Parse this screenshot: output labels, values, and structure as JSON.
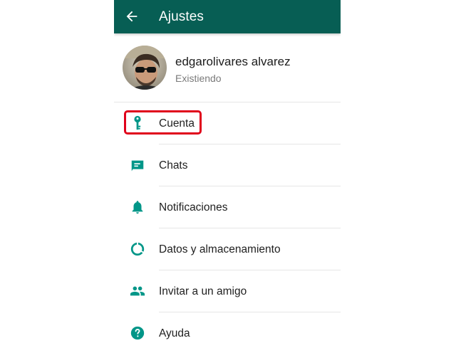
{
  "appbar": {
    "title": "Ajustes",
    "back_icon": "arrow-left-icon"
  },
  "profile": {
    "name": "edgarolivares alvarez",
    "status": "Existiendo"
  },
  "settings": {
    "items": [
      {
        "label": "Cuenta",
        "icon": "key-icon"
      },
      {
        "label": "Chats",
        "icon": "chat-icon"
      },
      {
        "label": "Notificaciones",
        "icon": "bell-icon"
      },
      {
        "label": "Datos y almacenamiento",
        "icon": "data-usage-icon"
      },
      {
        "label": "Invitar a un amigo",
        "icon": "people-icon"
      },
      {
        "label": "Ayuda",
        "icon": "help-icon"
      }
    ]
  },
  "colors": {
    "appbar": "#075e54",
    "icon_teal": "#009688",
    "highlight": "#e0001b"
  }
}
